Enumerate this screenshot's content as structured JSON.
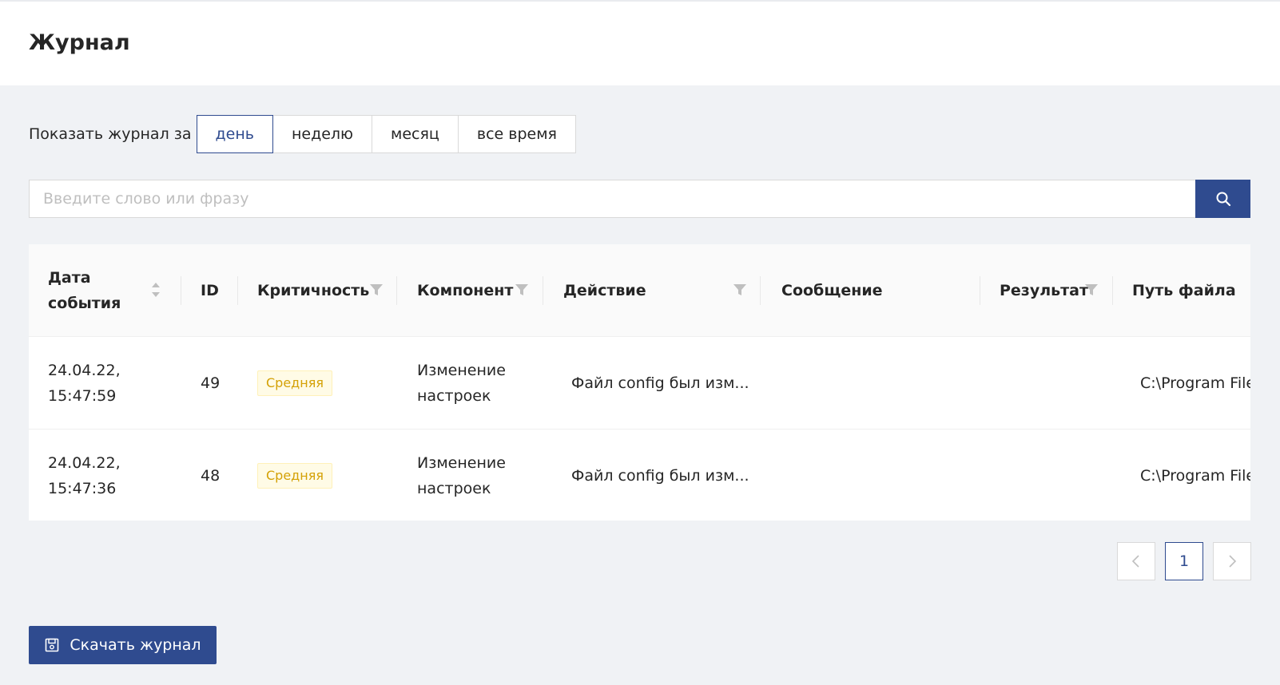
{
  "page": {
    "title": "Журнал"
  },
  "period_filter": {
    "label": "Показать журнал за",
    "options": [
      "день",
      "неделю",
      "месяц",
      "все время"
    ],
    "selected": "день"
  },
  "search": {
    "placeholder": "Введите слово или фразу",
    "value": "",
    "button_icon": "search-icon"
  },
  "table": {
    "columns": [
      {
        "label_line1": "Дата",
        "label_line2": "события",
        "control": "sort-icon"
      },
      {
        "label": "ID"
      },
      {
        "label": "Критичность",
        "control": "filter-icon"
      },
      {
        "label": "Компонент",
        "control": "filter-icon"
      },
      {
        "label": "Действие",
        "control": "filter-icon"
      },
      {
        "label": "Сообщение"
      },
      {
        "label": "Результат",
        "control": "filter-icon"
      },
      {
        "label": "Путь файла"
      }
    ],
    "rows": [
      {
        "date_line1": "24.04.22,",
        "date_line2": "15:47:59",
        "id": "49",
        "severity": "Средняя",
        "component_line1": "Изменение",
        "component_line2": "настроек",
        "action": "Файл config был изм...",
        "message": "",
        "result": "",
        "path": "C:\\Program Files (x"
      },
      {
        "date_line1": "24.04.22,",
        "date_line2": "15:47:36",
        "id": "48",
        "severity": "Средняя",
        "component_line1": "Изменение",
        "component_line2": "настроек",
        "action": "Файл config был изм...",
        "message": "",
        "result": "",
        "path": "C:\\Program Files (x"
      }
    ]
  },
  "pagination": {
    "prev_icon": "chevron-left-icon",
    "current_page": "1",
    "next_icon": "chevron-right-icon"
  },
  "download": {
    "label": "Скачать журнал",
    "icon": "save-icon"
  },
  "colors": {
    "accent": "#2f4b8f",
    "background": "#f0f2f5",
    "badge_text": "#d4a106",
    "badge_bg": "#fffbe6"
  }
}
